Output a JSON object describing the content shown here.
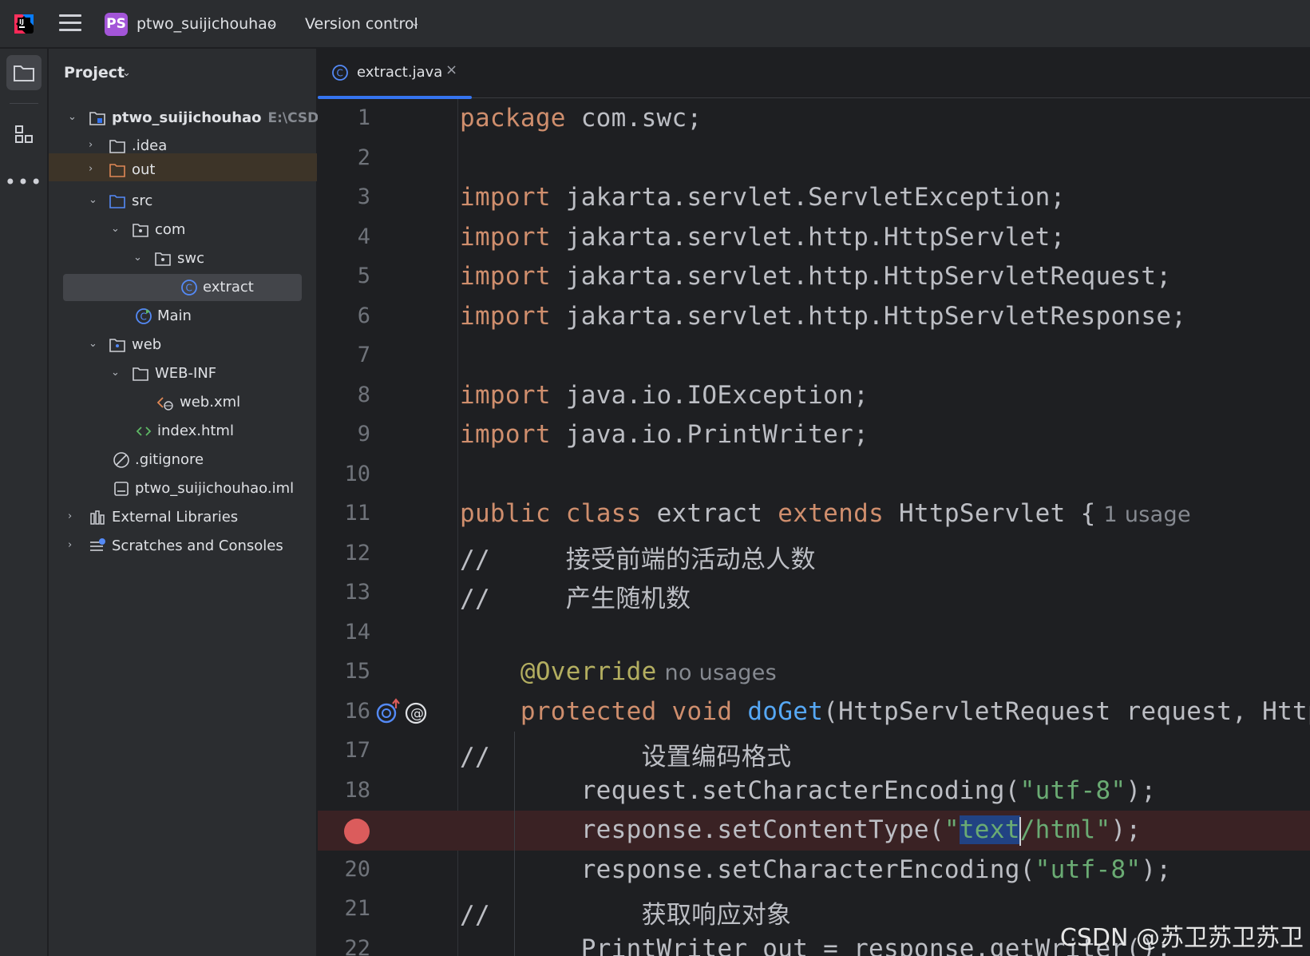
{
  "titlebar": {
    "project_badge": "PS",
    "project_name": "ptwo_suijichouhao",
    "vcs_label": "Version control"
  },
  "project_panel": {
    "header": "Project",
    "tree": [
      {
        "label": "ptwo_suijichouhao",
        "path": "E:\\CSDN\\",
        "icon": "module-folder-icon",
        "expanded": true
      },
      {
        "label": ".idea",
        "icon": "folder-icon",
        "expanded": false
      },
      {
        "label": "out",
        "icon": "folder-icon",
        "expanded": false
      },
      {
        "label": "src",
        "icon": "source-folder-icon",
        "expanded": true
      },
      {
        "label": "com",
        "icon": "package-icon",
        "expanded": true
      },
      {
        "label": "swc",
        "icon": "package-icon",
        "expanded": true
      },
      {
        "label": "extract",
        "icon": "java-class-icon"
      },
      {
        "label": "Main",
        "icon": "java-main-class-icon"
      },
      {
        "label": "web",
        "icon": "web-folder-icon",
        "expanded": true
      },
      {
        "label": "WEB-INF",
        "icon": "folder-icon",
        "expanded": true
      },
      {
        "label": "web.xml",
        "icon": "xml-file-icon"
      },
      {
        "label": "index.html",
        "icon": "html-file-icon"
      },
      {
        "label": ".gitignore",
        "icon": "ignore-file-icon"
      },
      {
        "label": "ptwo_suijichouhao.iml",
        "icon": "iml-file-icon"
      },
      {
        "label": "External Libraries",
        "icon": "library-icon",
        "expanded": false
      },
      {
        "label": "Scratches and Consoles",
        "icon": "scratches-icon",
        "expanded": false
      }
    ]
  },
  "editor": {
    "tab_label": "extract.java",
    "line_numbers": [
      "1",
      "2",
      "3",
      "4",
      "5",
      "6",
      "7",
      "8",
      "9",
      "10",
      "11",
      "12",
      "13",
      "14",
      "15",
      "16",
      "17",
      "18",
      "",
      "20",
      "21",
      "22"
    ],
    "breakpoint_line_index": 18,
    "code": {
      "l1_kw": "package",
      "l1_rest": " com.swc;",
      "l3_kw": "import",
      "l3_rest": " jakarta.servlet.ServletException;",
      "l4_kw": "import",
      "l4_rest": " jakarta.servlet.http.HttpServlet;",
      "l5_kw": "import",
      "l5_rest": " jakarta.servlet.http.HttpServletRequest;",
      "l6_kw": "import",
      "l6_rest": " jakarta.servlet.http.HttpServletResponse;",
      "l8_kw": "import",
      "l8_rest": " java.io.IOException;",
      "l9_kw": "import",
      "l9_rest": " java.io.PrintWriter;",
      "l11_kw1": "public",
      "l11_kw2": "class",
      "l11_name": "extract",
      "l11_kw3": "extends",
      "l11_rest": "HttpServlet {",
      "l11_hint": "1 usage",
      "l12": "//     接受前端的活动总人数",
      "l13": "//     产生随机数",
      "l15_ann": "@Override",
      "l15_hint": "no usages",
      "l16_kw1": "protected",
      "l16_kw2": "void",
      "l16_fn": "doGet",
      "l16_rest": "(HttpServletRequest request, HttpSe",
      "l17": "//          设置编码格式",
      "l18_pre": "request.setCharacterEncoding(",
      "l18_str": "\"utf-8\"",
      "l18_post": ");",
      "l19_pre": "response.setContentType(",
      "l19_q1": "\"",
      "l19_sel": "text",
      "l19_str2": "/html\"",
      "l19_post": ");",
      "l20_pre": "response.setCharacterEncoding(",
      "l20_str": "\"utf-8\"",
      "l20_post": ");",
      "l21": "//          获取响应对象",
      "l22": "PrintWriter out = response.getWriter();"
    }
  },
  "watermark": "CSDN @苏卫苏卫苏卫",
  "colors": {
    "keyword": "#cf8e6d",
    "string": "#6aab73",
    "comment": "#7a7e85",
    "annotation": "#b3ae60",
    "function": "#56a8f5",
    "accent": "#3574f0",
    "breakpoint": "#db5c5c"
  }
}
